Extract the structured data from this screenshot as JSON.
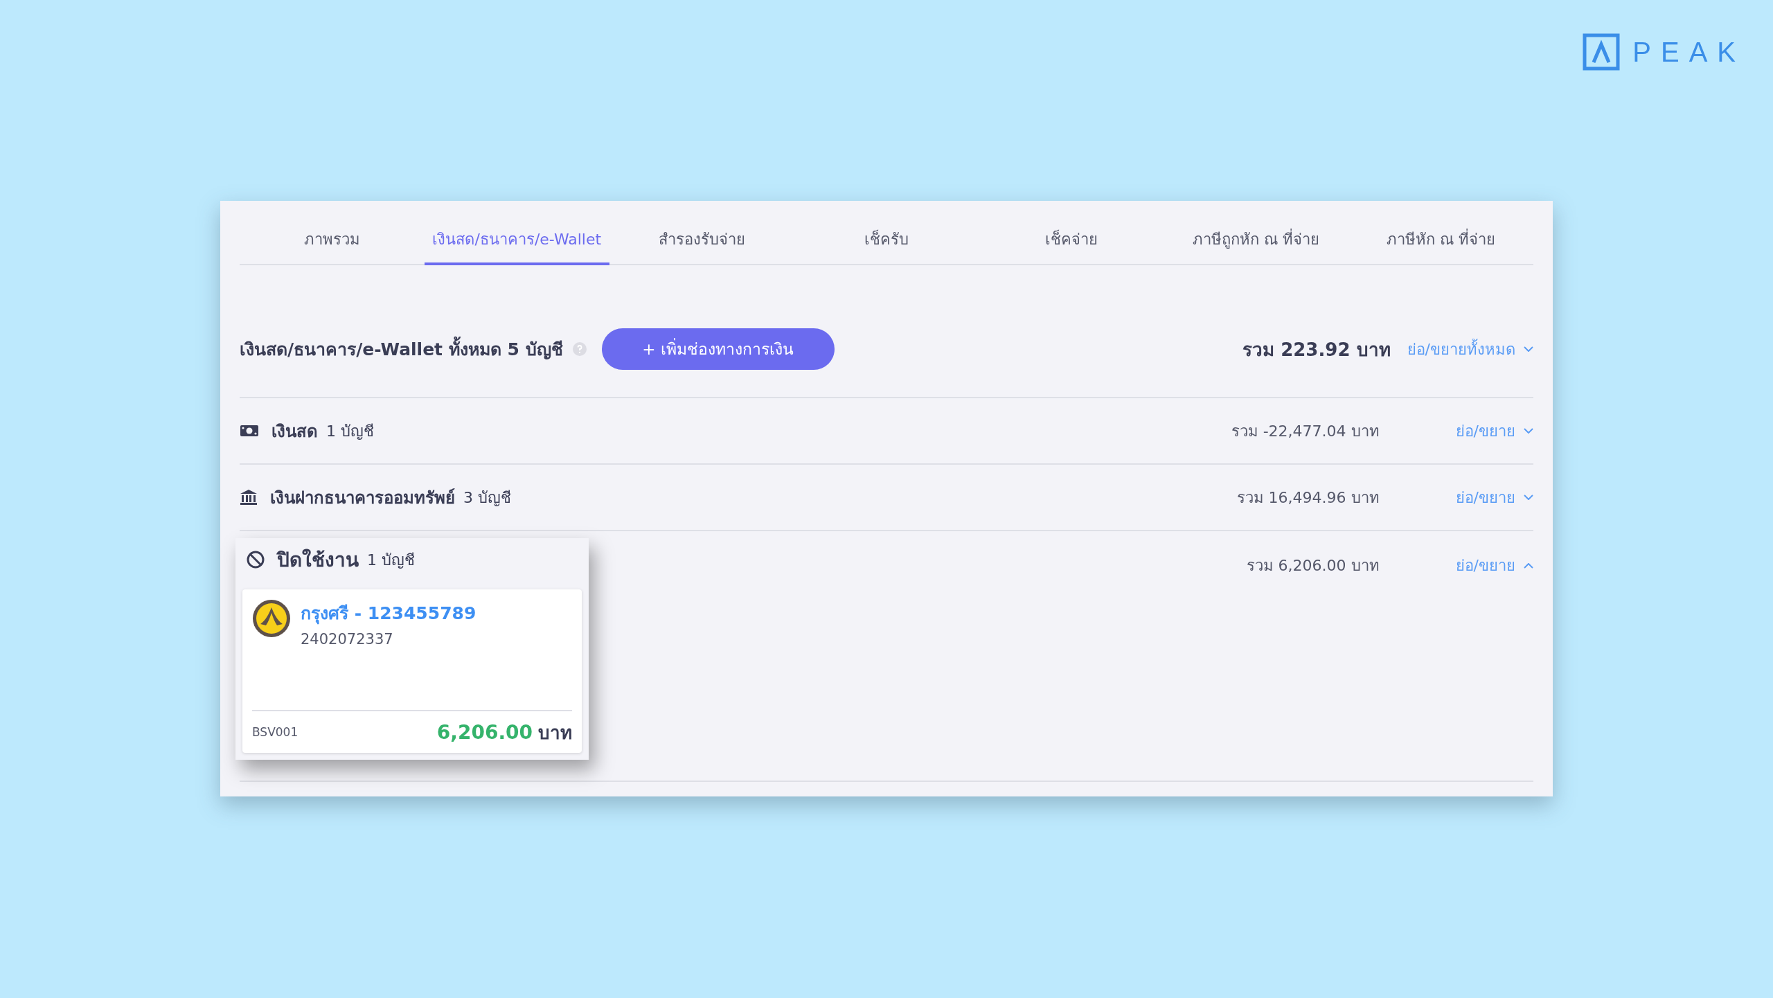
{
  "logo": {
    "text": "PEAK"
  },
  "tabs": [
    {
      "label": "ภาพรวม",
      "selected": false
    },
    {
      "label": "เงินสด/ธนาคาร/e-Wallet",
      "selected": true
    },
    {
      "label": "สำรองรับจ่าย",
      "selected": false
    },
    {
      "label": "เช็ครับ",
      "selected": false
    },
    {
      "label": "เช็คจ่าย",
      "selected": false
    },
    {
      "label": "ภาษีถูกหัก ณ ที่จ่าย",
      "selected": false
    },
    {
      "label": "ภาษีหัก ณ ที่จ่าย",
      "selected": false
    }
  ],
  "summary": {
    "title": "เงินสด/ธนาคาร/e-Wallet ทั้งหมด 5 บัญชี",
    "add_button": "+ เพิ่มช่องทางการเงิน",
    "total": "รวม 223.92 บาท",
    "toggle_all": "ย่อ/ขยายทั้งหมด"
  },
  "groups": [
    {
      "kind": "cash",
      "name": "เงินสด",
      "count": "1 บัญชี",
      "total": "รวม -22,477.04 บาท",
      "toggle": "ย่อ/ขยาย",
      "expanded": false
    },
    {
      "kind": "bank",
      "name": "เงินฝากธนาคารออมทรัพย์",
      "count": "3 บัญชี",
      "total": "รวม 16,494.96 บาท",
      "toggle": "ย่อ/ขยาย",
      "expanded": false
    },
    {
      "kind": "disabled",
      "name": "ปิดใช้งาน",
      "count": "1 บัญชี",
      "total": "รวม 6,206.00 บาท",
      "toggle": "ย่อ/ขยาย",
      "expanded": true,
      "accounts": [
        {
          "name": "กรุงศรี - 123455789",
          "number": "2402072337",
          "code": "BSV001",
          "amount": "6,206.00",
          "currency": "บาท"
        }
      ]
    }
  ]
}
